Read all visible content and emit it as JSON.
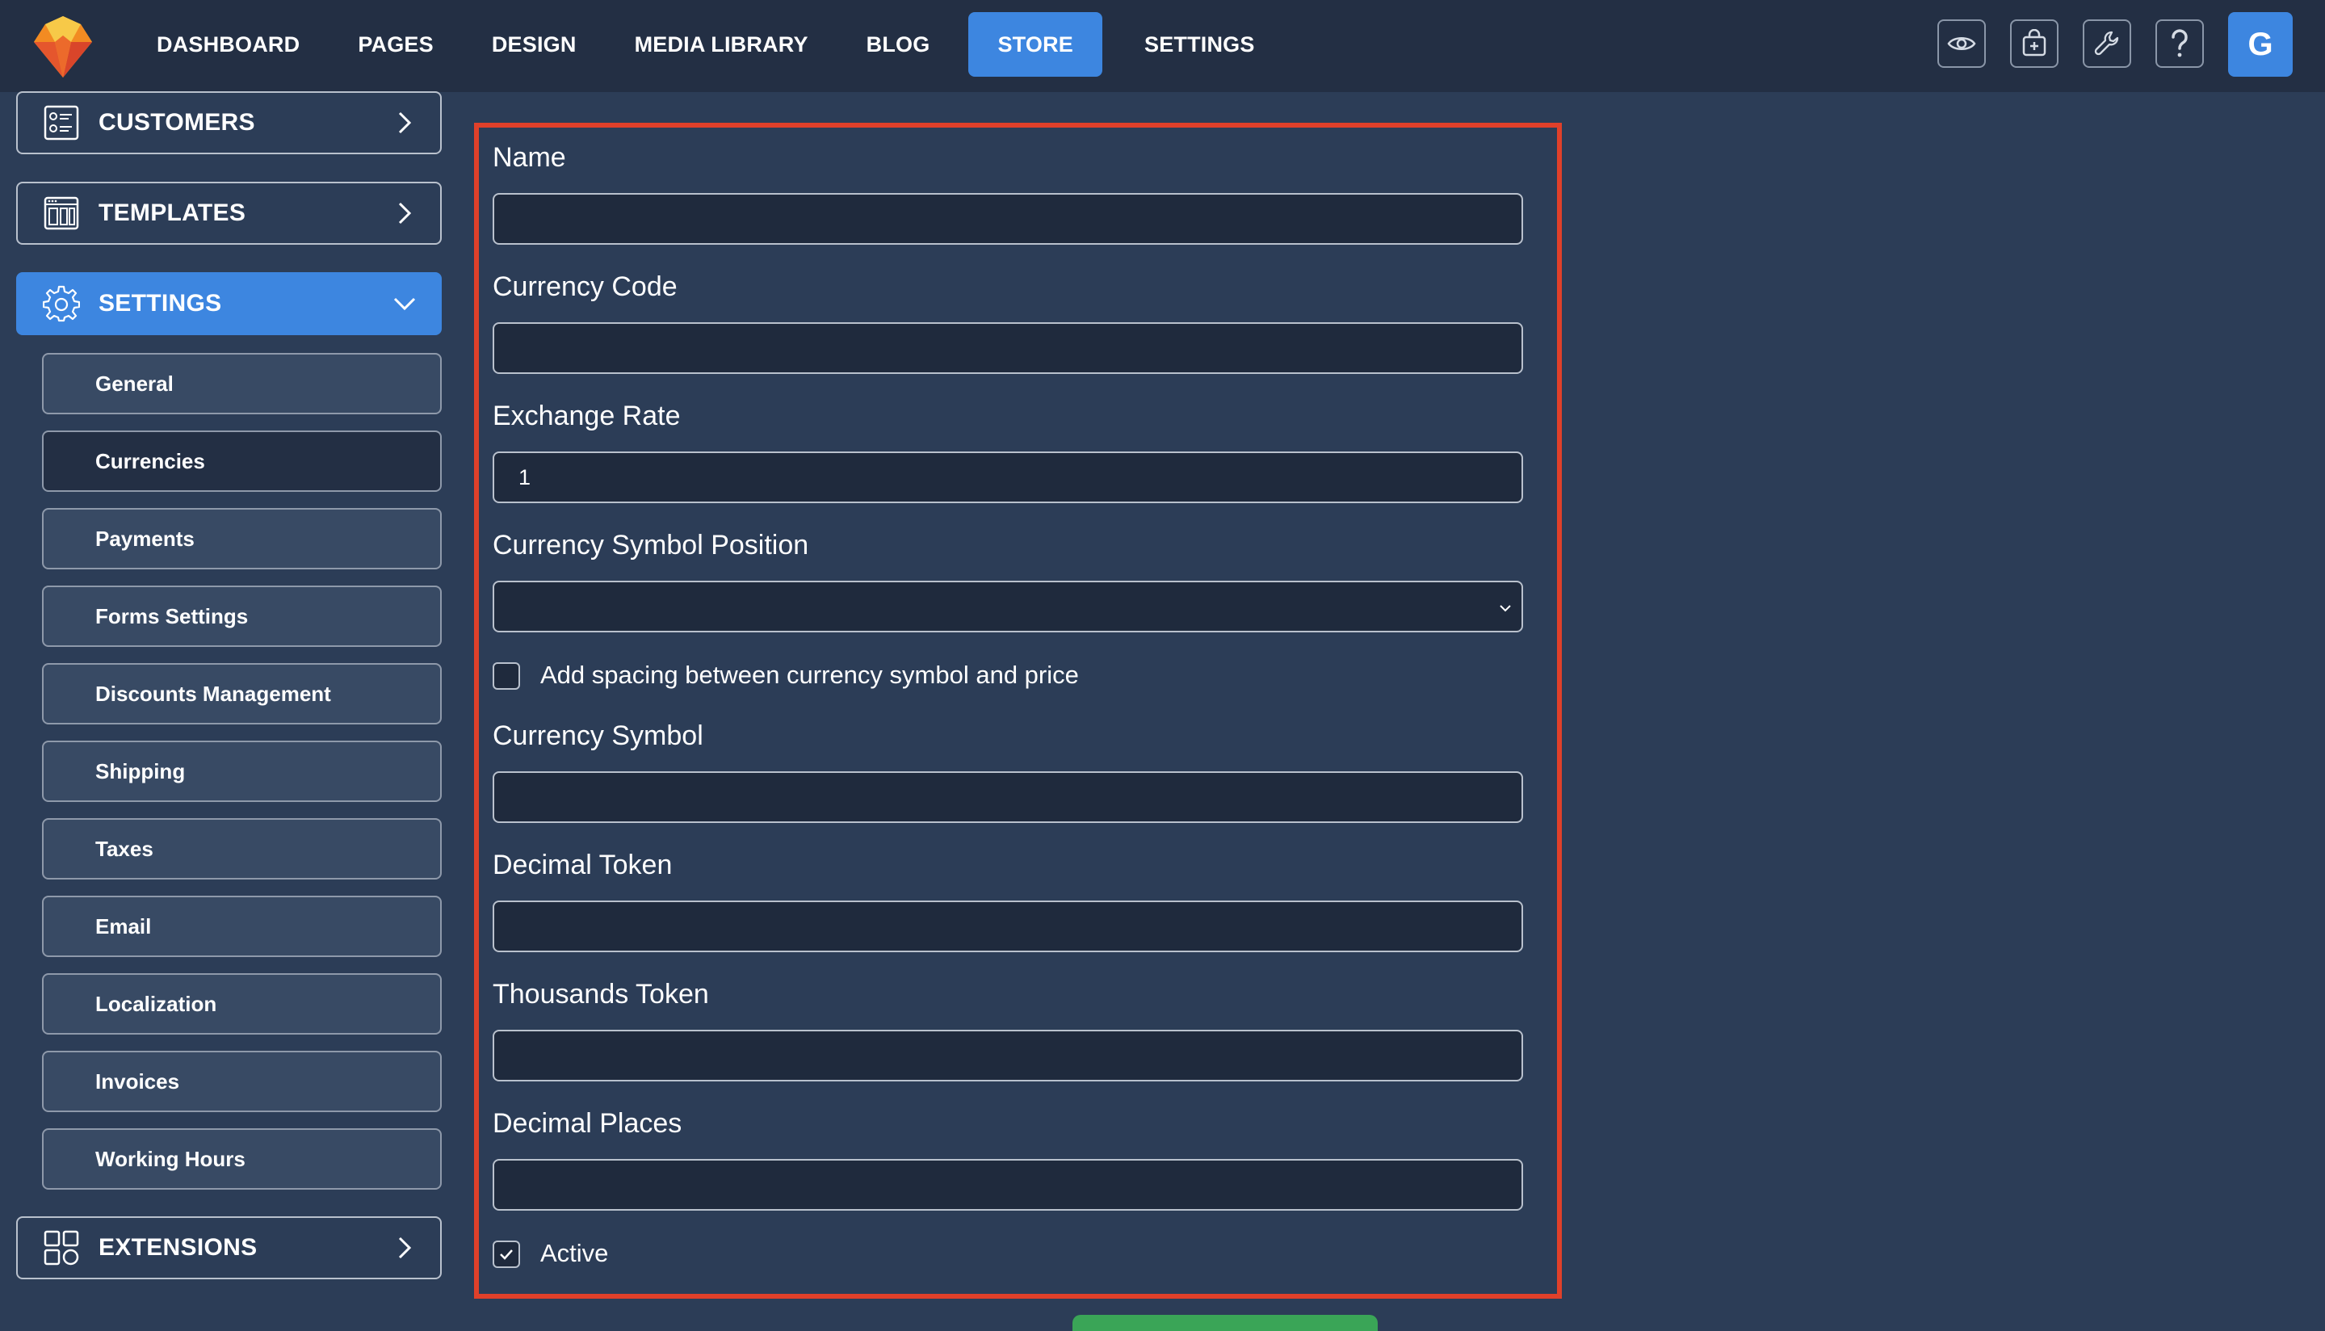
{
  "topnav": {
    "items": [
      "DASHBOARD",
      "PAGES",
      "DESIGN",
      "MEDIA LIBRARY",
      "BLOG",
      "STORE",
      "SETTINGS"
    ],
    "active": "STORE",
    "tools": [
      "eye-icon",
      "shopping-bag-plus-icon",
      "wrench-icon",
      "question-icon"
    ],
    "avatar_letter": "G"
  },
  "sidebar": {
    "customers": "CUSTOMERS",
    "templates": "TEMPLATES",
    "settings": "SETTINGS",
    "extensions": "EXTENSIONS",
    "sub_items": [
      "General",
      "Currencies",
      "Payments",
      "Forms Settings",
      "Discounts Management",
      "Shipping",
      "Taxes",
      "Email",
      "Localization",
      "Invoices",
      "Working Hours"
    ],
    "active_sub_item": "Currencies"
  },
  "form": {
    "name_label": "Name",
    "name_value": "",
    "currency_code_label": "Currency Code",
    "currency_code_value": "",
    "exchange_rate_label": "Exchange Rate",
    "exchange_rate_value": "1",
    "symbol_position_label": "Currency Symbol Position",
    "symbol_position_value": "",
    "spacing_label": "Add spacing between currency symbol and price",
    "spacing_checked": false,
    "currency_symbol_label": "Currency Symbol",
    "currency_symbol_value": "",
    "decimal_token_label": "Decimal Token",
    "decimal_token_value": "",
    "thousands_token_label": "Thousands Token",
    "thousands_token_value": "",
    "decimal_places_label": "Decimal Places",
    "decimal_places_value": "",
    "active_label": "Active",
    "active_checked": true
  },
  "colors": {
    "accent": "#3d86e0",
    "highlight": "#e0402a",
    "save": "#3aa557"
  }
}
